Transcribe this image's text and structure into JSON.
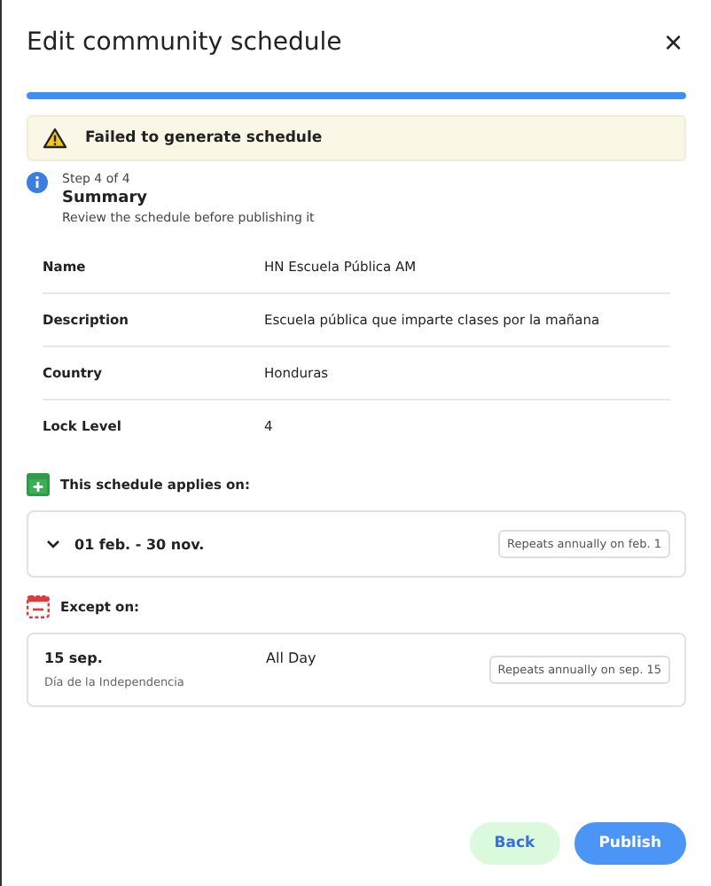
{
  "dialog": {
    "title": "Edit community schedule",
    "close": "×"
  },
  "progress": {
    "level": 1
  },
  "alert": {
    "text": "Failed to generate schedule"
  },
  "step": {
    "counter": "Step 4 of 4",
    "title": "Summary",
    "subtitle": "Review the schedule before publishing it"
  },
  "details": [
    {
      "label": "Name",
      "value": "HN Escuela Pública AM"
    },
    {
      "label": "Description",
      "value": "Escuela pública que imparte clases por la mañana"
    },
    {
      "label": "Country",
      "value": "Honduras"
    },
    {
      "label": "Lock Level",
      "value": "4"
    }
  ],
  "applies": {
    "heading": "This schedule applies on:",
    "range": "01 feb. - 30 nov.",
    "expanded": false,
    "repeat": "Repeats annually on feb. 1"
  },
  "exceptions": {
    "heading": "Except on:",
    "items": [
      {
        "date": "15 sep.",
        "name": "Día de la Independencia",
        "time": "All Day",
        "repeat": "Repeats annually on sep. 15"
      }
    ]
  },
  "buttons": [
    {
      "label": "Back",
      "kind": "secondary"
    },
    {
      "label": "Publish",
      "kind": "primary"
    }
  ]
}
